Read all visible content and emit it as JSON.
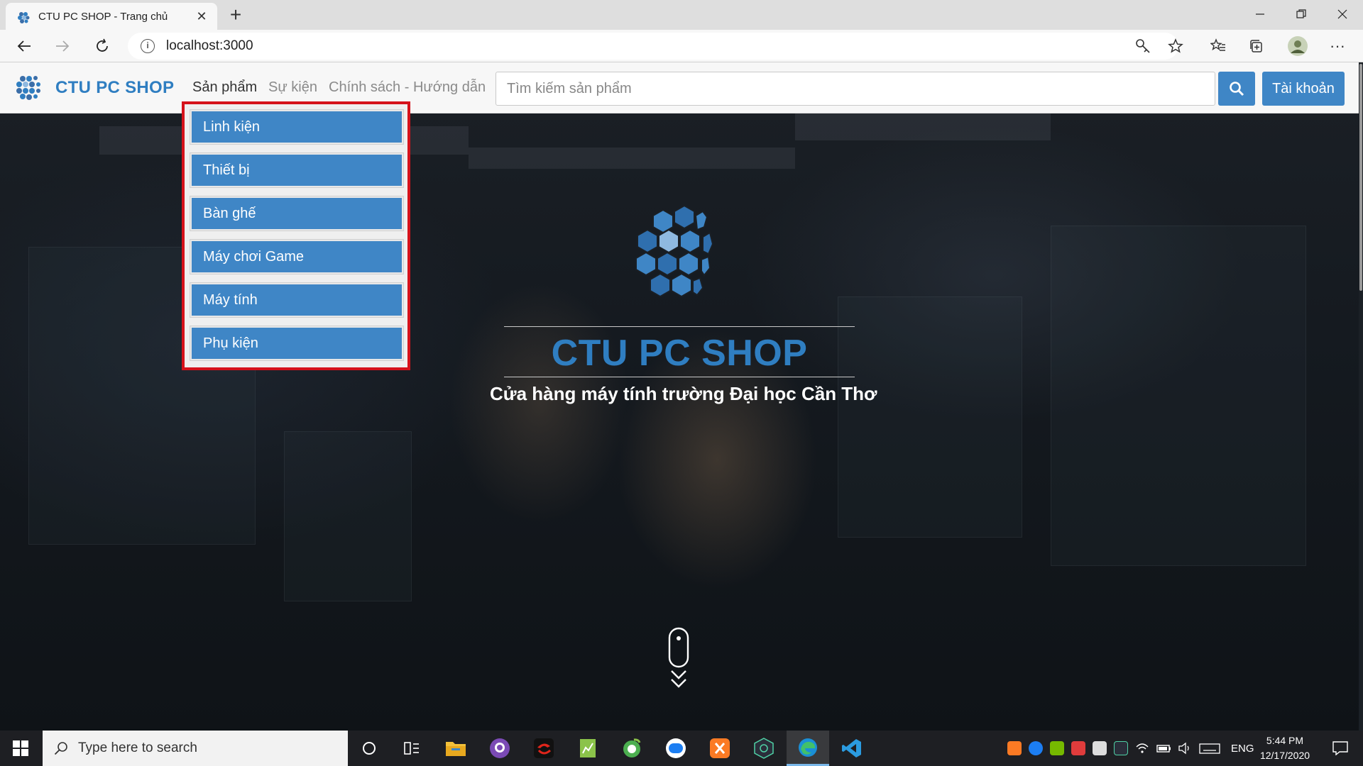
{
  "browser": {
    "tab_title": "CTU PC SHOP - Trang chủ",
    "tab_close": "✕",
    "new_tab": "+",
    "url": "localhost:3000",
    "more_label": "···"
  },
  "navbar": {
    "brand": "CTU PC SHOP",
    "links": [
      {
        "label": "Sản phẩm",
        "active": true
      },
      {
        "label": "Sự kiện",
        "active": false
      },
      {
        "label": "Chính sách - Hướng dẫn",
        "active": false
      }
    ],
    "search_placeholder": "Tìm kiếm sản phẩm",
    "account_label": "Tài khoản"
  },
  "dropdown": {
    "items": [
      "Linh kiện",
      "Thiết bị",
      "Bàn ghế",
      "Máy chơi Game",
      "Máy tính",
      "Phụ kiện"
    ]
  },
  "hero": {
    "title": "CTU PC SHOP",
    "subtitle": "Cửa hàng máy tính trường Đại học Cần Thơ"
  },
  "taskbar": {
    "search_placeholder": "Type here to search",
    "language": "ENG",
    "time": "5:44 PM",
    "date": "12/17/2020"
  },
  "colors": {
    "brand_blue": "#2f7ec1",
    "button_blue": "#3f86c6",
    "highlight_red": "#d5121b"
  },
  "icons": [
    "windows-start-icon",
    "search-icon",
    "cortana-icon",
    "task-view-icon",
    "file-explorer-icon",
    "github-icon",
    "garena-icon",
    "notepad-icon",
    "coccoc-icon",
    "zalo-icon",
    "xampp-icon",
    "nox-icon",
    "edge-icon",
    "vscode-icon"
  ]
}
